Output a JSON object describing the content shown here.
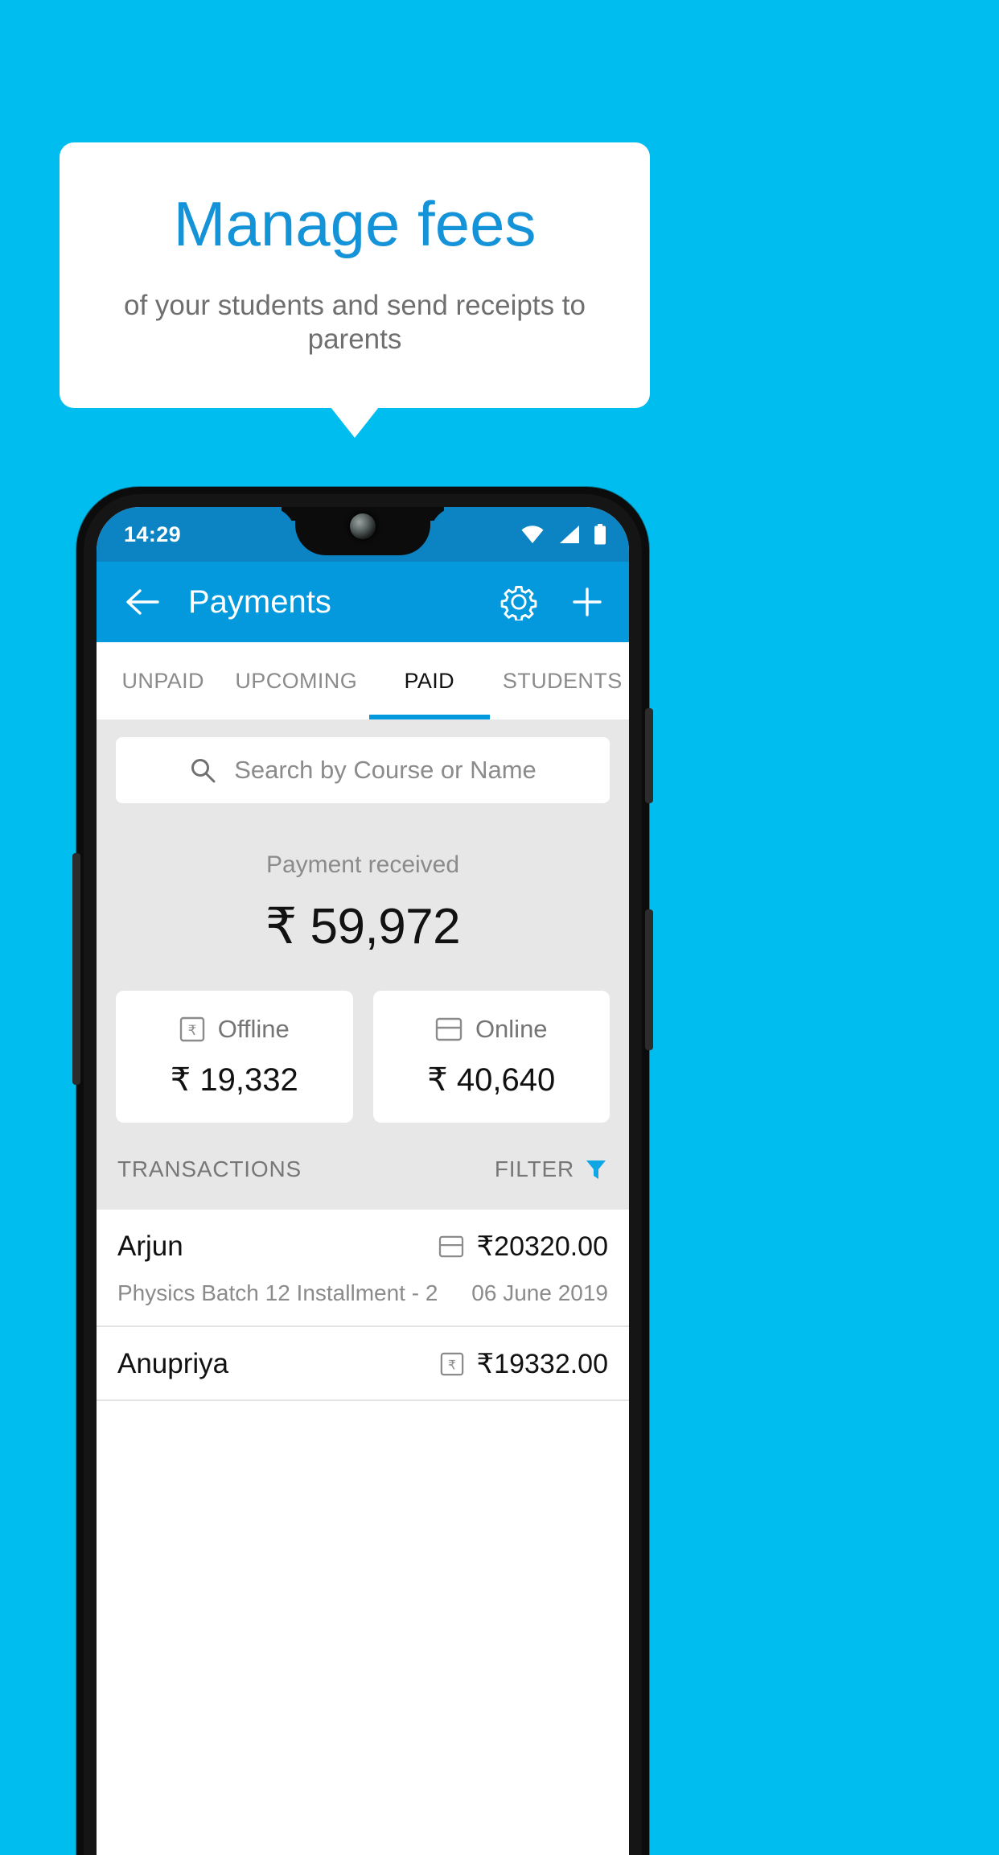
{
  "promo": {
    "title": "Manage fees",
    "subtitle": "of your students and send receipts to parents",
    "title_color": "#1593d8",
    "background_color": "#00bdef"
  },
  "phone": {
    "status_bar": {
      "time": "14:29",
      "icons": [
        "wifi-icon",
        "cellular-signal-icon",
        "battery-full-icon"
      ]
    },
    "app_bar": {
      "back_icon": "back-arrow-icon",
      "title": "Payments",
      "settings_icon": "gear-icon",
      "add_icon": "plus-icon",
      "color": "#0399dc"
    },
    "tabs": [
      {
        "label": "UNPAID",
        "active": false
      },
      {
        "label": "UPCOMING",
        "active": false
      },
      {
        "label": "PAID",
        "active": true
      },
      {
        "label": "STUDENTS",
        "active": false
      }
    ],
    "search": {
      "icon": "search-icon",
      "placeholder": "Search by Course or Name",
      "value": ""
    },
    "summary": {
      "label": "Payment received",
      "amount": "₹ 59,972"
    },
    "split_cards": [
      {
        "icon": "rupee-note-icon",
        "label": "Offline",
        "amount": "₹ 19,332"
      },
      {
        "icon": "credit-card-icon",
        "label": "Online",
        "amount": "₹ 40,640"
      }
    ],
    "transactions_header": {
      "label": "TRANSACTIONS",
      "filter_label": "FILTER",
      "filter_icon": "filter-funnel-icon",
      "filter_color": "#0fa6e4"
    },
    "transactions": [
      {
        "name": "Arjun",
        "course": "Physics Batch 12 Installment - 2",
        "amount": "₹20320.00",
        "date": "06 June 2019",
        "method_icon": "credit-card-icon"
      },
      {
        "name": "Anupriya",
        "course": "",
        "amount": "₹19332.00",
        "date": "",
        "method_icon": "rupee-note-icon"
      }
    ]
  }
}
